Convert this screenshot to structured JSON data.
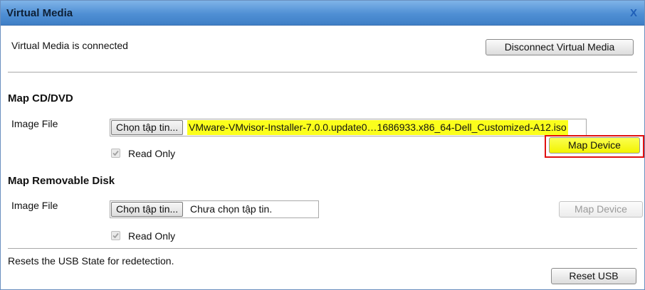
{
  "window": {
    "title": "Virtual Media",
    "close_label": "X"
  },
  "status": {
    "text": "Virtual Media is connected",
    "disconnect_label": "Disconnect Virtual Media"
  },
  "cd_dvd": {
    "heading": "Map CD/DVD",
    "image_file_label": "Image File",
    "choose_label": "Chọn tập tin...",
    "file_name": "VMware-VMvisor-Installer-7.0.0.update0…1686933.x86_64-Dell_Customized-A12.iso",
    "read_only_label": "Read Only",
    "read_only_checked": true,
    "map_label": "Map Device",
    "map_enabled": true
  },
  "removable": {
    "heading": "Map Removable Disk",
    "image_file_label": "Image File",
    "choose_label": "Chọn tập tin...",
    "file_name": "Chưa chọn tập tin.",
    "read_only_label": "Read Only",
    "read_only_checked": true,
    "map_label": "Map Device",
    "map_enabled": false
  },
  "usb": {
    "text": "Resets the USB State for redetection.",
    "reset_label": "Reset USB"
  },
  "colors": {
    "highlight": "#fbff1c",
    "annotation_red": "#e01010",
    "title_bar": "#4f8fd4"
  }
}
